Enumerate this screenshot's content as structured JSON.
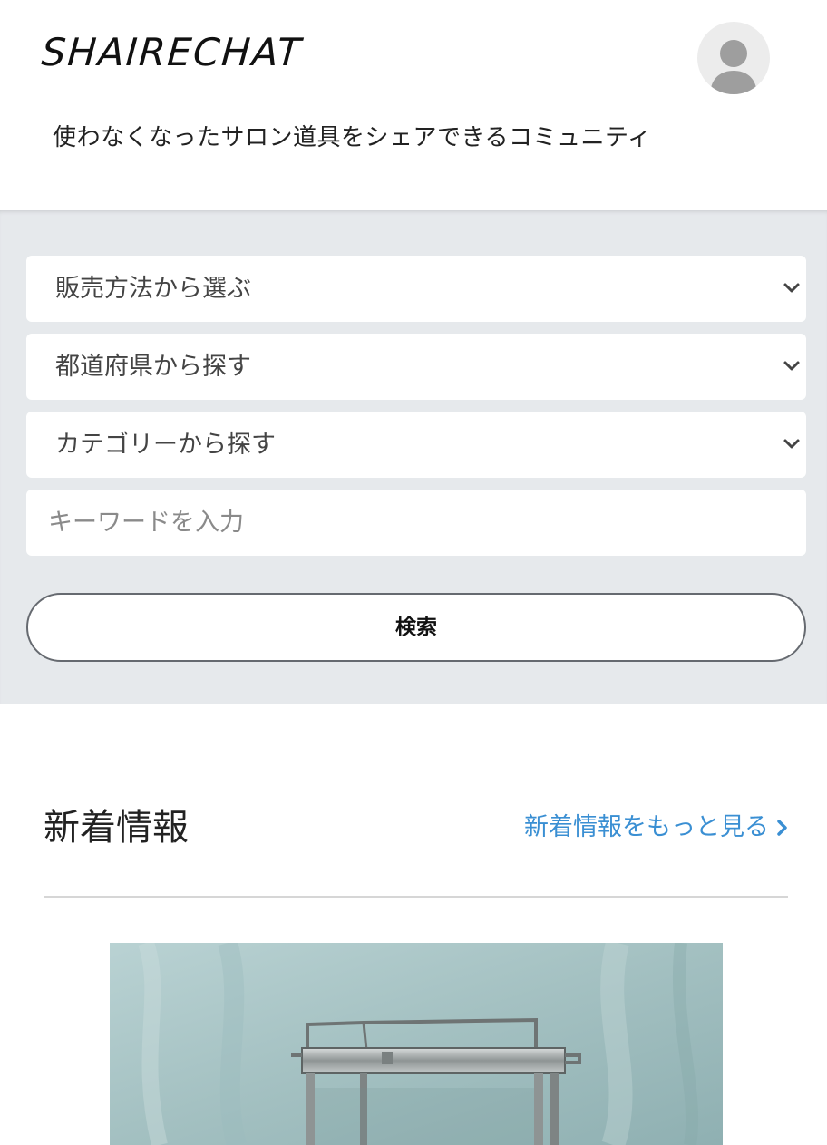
{
  "header": {
    "logo_text": "SHAIRECHAT",
    "tagline": "使わなくなったサロン道具をシェアできるコミュニティ",
    "avatar_icon": "user-avatar-icon"
  },
  "search": {
    "sales_method_select": "販売方法から選ぶ",
    "prefecture_select": "都道府県から探す",
    "category_select": "カテゴリーから探す",
    "keyword_placeholder": "キーワードを入力",
    "keyword_value": "",
    "search_button_label": "検索",
    "chevron_icon": "chevron-down-icon"
  },
  "news": {
    "title": "新着情報",
    "more_link": "新着情報をもっと見る",
    "more_icon": "chevron-right-icon",
    "link_color": "#3a8fd3"
  },
  "colors": {
    "panel_background": "#e6e9ec",
    "button_border": "#666a70",
    "accent": "#3a8fd3"
  }
}
